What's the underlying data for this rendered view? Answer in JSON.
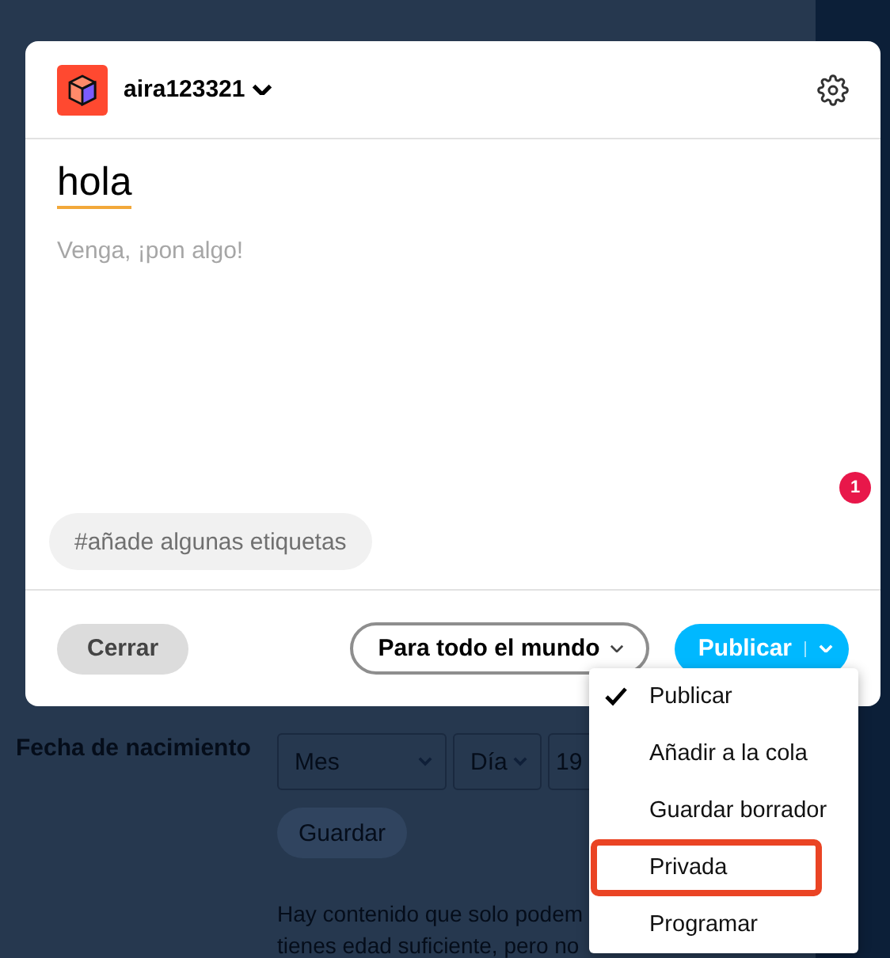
{
  "background": {
    "birthdate": {
      "label": "Fecha de nacimiento",
      "selects": [
        "Mes",
        "Día",
        "19"
      ],
      "save": "Guardar",
      "note": [
        "Hay contenido que solo podem",
        "tienes edad suficiente, pero no"
      ]
    }
  },
  "post": {
    "account": "aira123321",
    "title": "hola",
    "body_placeholder": "Venga, ¡pon algo!",
    "badge": "1",
    "tags_placeholder": "#añade algunas etiquetas",
    "close": "Cerrar",
    "audience": "Para todo el mundo",
    "publish": "Publicar"
  },
  "menu": [
    {
      "label": "Publicar",
      "selected": true,
      "highlighted": false
    },
    {
      "label": "Añadir a la cola",
      "selected": false,
      "highlighted": false
    },
    {
      "label": "Guardar borrador",
      "selected": false,
      "highlighted": false
    },
    {
      "label": "Privada",
      "selected": false,
      "highlighted": true
    },
    {
      "label": "Programar",
      "selected": false,
      "highlighted": false
    }
  ]
}
